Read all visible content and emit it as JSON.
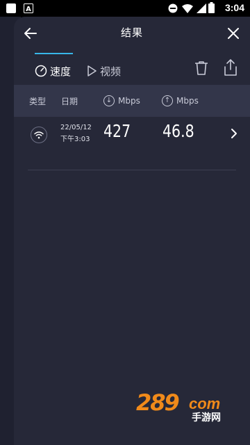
{
  "status_bar": {
    "time": "3:04",
    "icons": [
      "app-square-icon",
      "keyboard-a-icon",
      "do-not-disturb-icon",
      "wifi-signal-icon",
      "cell-signal-icon",
      "battery-icon"
    ]
  },
  "header": {
    "title": "结果",
    "back_icon": "arrow-left-icon",
    "close_icon": "close-icon"
  },
  "tabs": [
    {
      "label": "速度",
      "icon": "speedometer-icon",
      "selected": true
    },
    {
      "label": "视频",
      "icon": "play-icon",
      "selected": false
    }
  ],
  "toolbar": {
    "delete_icon": "trash-icon",
    "share_icon": "share-icon"
  },
  "table": {
    "columns": {
      "type": "类型",
      "date": "日期",
      "download_unit": "Mbps",
      "upload_unit": "Mbps"
    },
    "rows": [
      {
        "type_icon": "wifi-icon",
        "date": "22/05/12",
        "time": "下午3:03",
        "download": "427",
        "upload": "46.8"
      }
    ]
  },
  "watermark": {
    "number": "289",
    "domain": "com",
    "subtitle": "手游网"
  },
  "colors": {
    "background": "#262838",
    "header_row": "#33364a",
    "accent": "#38b6e8",
    "watermark": "#f08a1a"
  }
}
